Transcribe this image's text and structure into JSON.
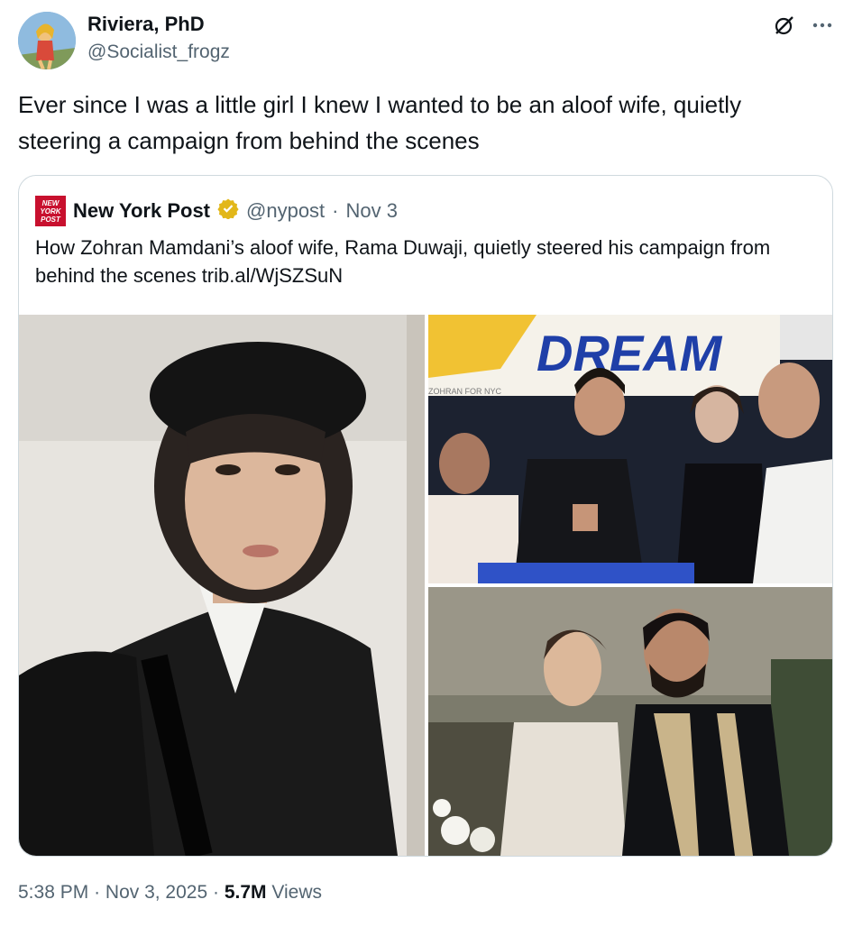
{
  "author": {
    "name": "Riviera, PhD",
    "handle": "@Socialist_frogz"
  },
  "tweet": {
    "text": "Ever since I was a little girl I knew I wanted to be an aloof wife, quietly steering a campaign from behind the scenes"
  },
  "quoted": {
    "logo_text": "NEW YORK POST",
    "name": "New York Post",
    "handle": "@nypost",
    "separator": "·",
    "date": "Nov 3",
    "text": "How Zohran Mamdani’s aloof wife, Rama Duwaji, quietly steered his campaign from behind the scenes trib.al/WjSZSuN",
    "images": [
      {
        "description_icon": "portrait-photo"
      },
      {
        "banner_text": "DREAM",
        "small_banner_text": "ZOHRAN FOR NYC"
      },
      {
        "description_icon": "couple-photo"
      }
    ]
  },
  "footer": {
    "time": "5:38 PM",
    "sep1": "·",
    "date": "Nov 3, 2025",
    "sep2": "·",
    "views_count": "5.7M",
    "views_label": "Views"
  },
  "colors": {
    "verified_gold": "#e2b719",
    "nypost_red": "#c8102e",
    "secondary_text": "#536471",
    "border": "#cfd9de"
  }
}
